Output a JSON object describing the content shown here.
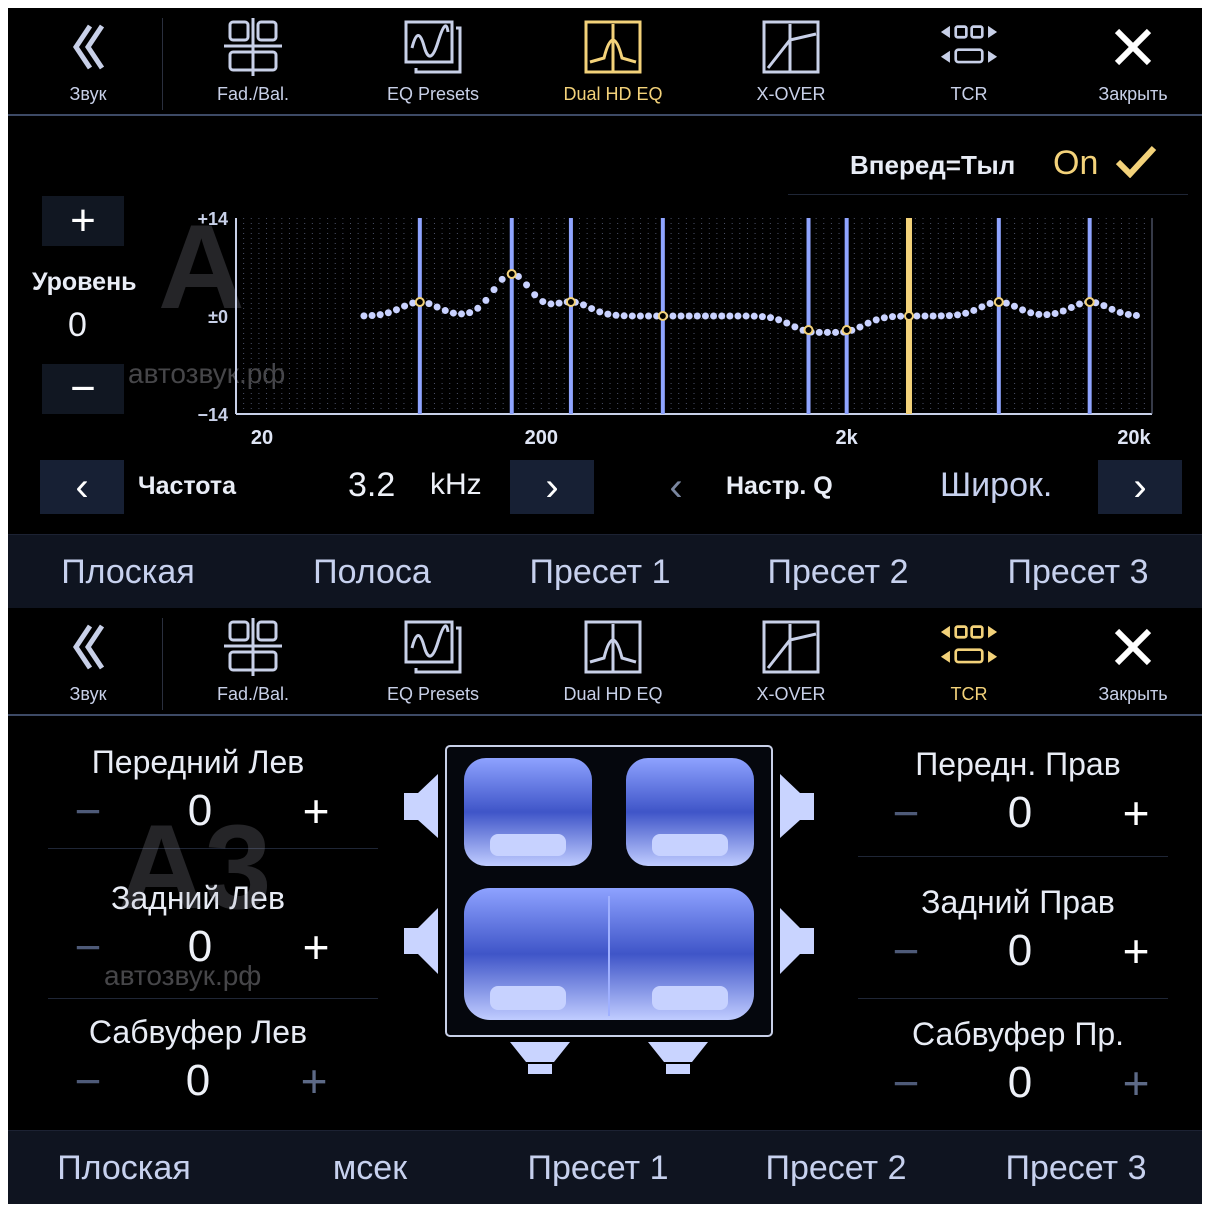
{
  "colors": {
    "accent": "#f3d27a",
    "band_line": "#8fa4ff",
    "background": "#000000",
    "tab_bar": "#0f1420"
  },
  "nav": {
    "items": [
      {
        "label": "Звук",
        "icon": "back-chevrons-icon"
      },
      {
        "label": "Fad./Bal.",
        "icon": "fader-balance-icon"
      },
      {
        "label": "EQ Presets",
        "icon": "eq-presets-icon"
      },
      {
        "label": "Dual HD EQ",
        "icon": "dual-hd-eq-icon"
      },
      {
        "label": "X-OVER",
        "icon": "crossover-icon"
      },
      {
        "label": "TCR",
        "icon": "time-correction-icon"
      },
      {
        "label": "Закрыть",
        "icon": "close-icon"
      }
    ]
  },
  "eq_screen": {
    "front_rear": {
      "label": "Вперед=Тыл",
      "value": "On"
    },
    "level": {
      "label": "Уровень",
      "value": "0",
      "plus": "+",
      "minus": "−"
    },
    "y_ticks": [
      "+14",
      "±0",
      "−14"
    ],
    "x_ticks": [
      "20",
      "200",
      "2k",
      "20k"
    ],
    "frequency": {
      "label": "Частота",
      "value": "3.2",
      "unit": "kHz"
    },
    "q": {
      "label": "Настр. Q",
      "value": "Широк."
    },
    "watermark": "автозвук.рф",
    "tabs": [
      "Плоская",
      "Полоса",
      "Пресет 1",
      "Пресет 2",
      "Пресет 3"
    ]
  },
  "chart_data": {
    "type": "line",
    "title": "",
    "xlabel": "",
    "ylabel": "",
    "x_scale": "log",
    "xlim": [
      20,
      20000
    ],
    "ylim": [
      -14,
      14
    ],
    "bands_hz": [
      80,
      160,
      250,
      500,
      1500,
      2000,
      3200,
      6300,
      12500
    ],
    "band_gains_db": [
      2,
      6,
      2,
      0,
      -2,
      -2,
      0,
      2,
      2
    ],
    "selected_band_hz": 3200,
    "grid": true
  },
  "tcr_screen": {
    "channels": {
      "front_left": {
        "label": "Передний Лев",
        "value": "0"
      },
      "front_right": {
        "label": "Передн. Прав",
        "value": "0"
      },
      "rear_left": {
        "label": "Задний Лев",
        "value": "0"
      },
      "rear_right": {
        "label": "Задний Прав",
        "value": "0"
      },
      "sub_left": {
        "label": "Сабвуфер Лев",
        "value": "0"
      },
      "sub_right": {
        "label": "Сабвуфер Пр.",
        "value": "0"
      }
    },
    "minus": "−",
    "plus": "+",
    "watermark": "автозвук.рф",
    "tabs": [
      "Плоская",
      "мсек",
      "Пресет 1",
      "Пресет 2",
      "Пресет 3"
    ]
  }
}
